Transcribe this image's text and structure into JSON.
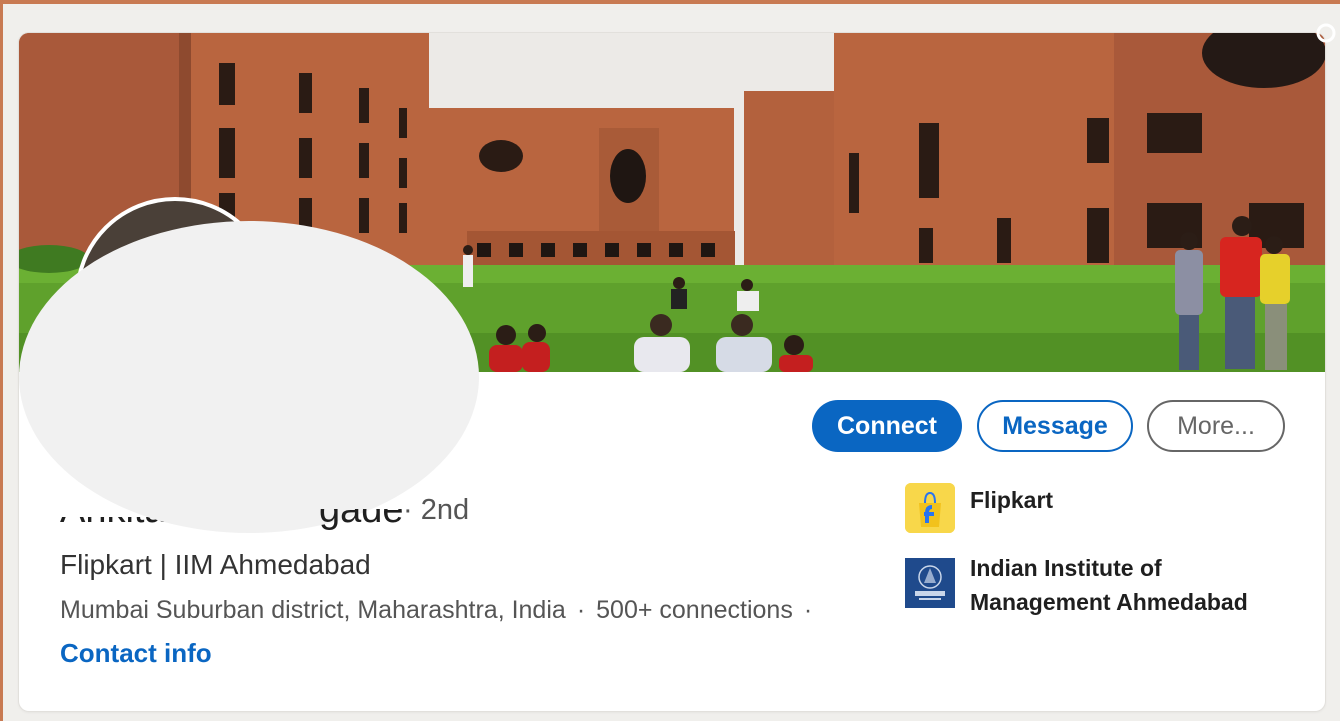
{
  "profile": {
    "name_visible": "Ankita",
    "name_visible_tail": "gade",
    "degree": "· 2nd",
    "headline": "Flipkart | IIM Ahmedabad",
    "location": "Mumbai Suburban district, Maharashtra, India",
    "connections": "500+ connections",
    "separator": "·",
    "contact_info": "Contact info"
  },
  "actions": {
    "connect_label": "Connect",
    "message_label": "Message",
    "more_label": "More..."
  },
  "companies": [
    {
      "name": "Flipkart",
      "logo_icon": "flipkart-logo",
      "logo_color": "#f8d74a"
    },
    {
      "name": "Indian Institute of Management Ahmedabad",
      "logo_icon": "iim-logo",
      "logo_color": "#1f4a8c"
    }
  ],
  "colors": {
    "accent": "#0a66c2",
    "cover_grass": "#5fa12c",
    "cover_brick": "#b8643c"
  },
  "icons": {
    "camera": "camera-icon"
  }
}
